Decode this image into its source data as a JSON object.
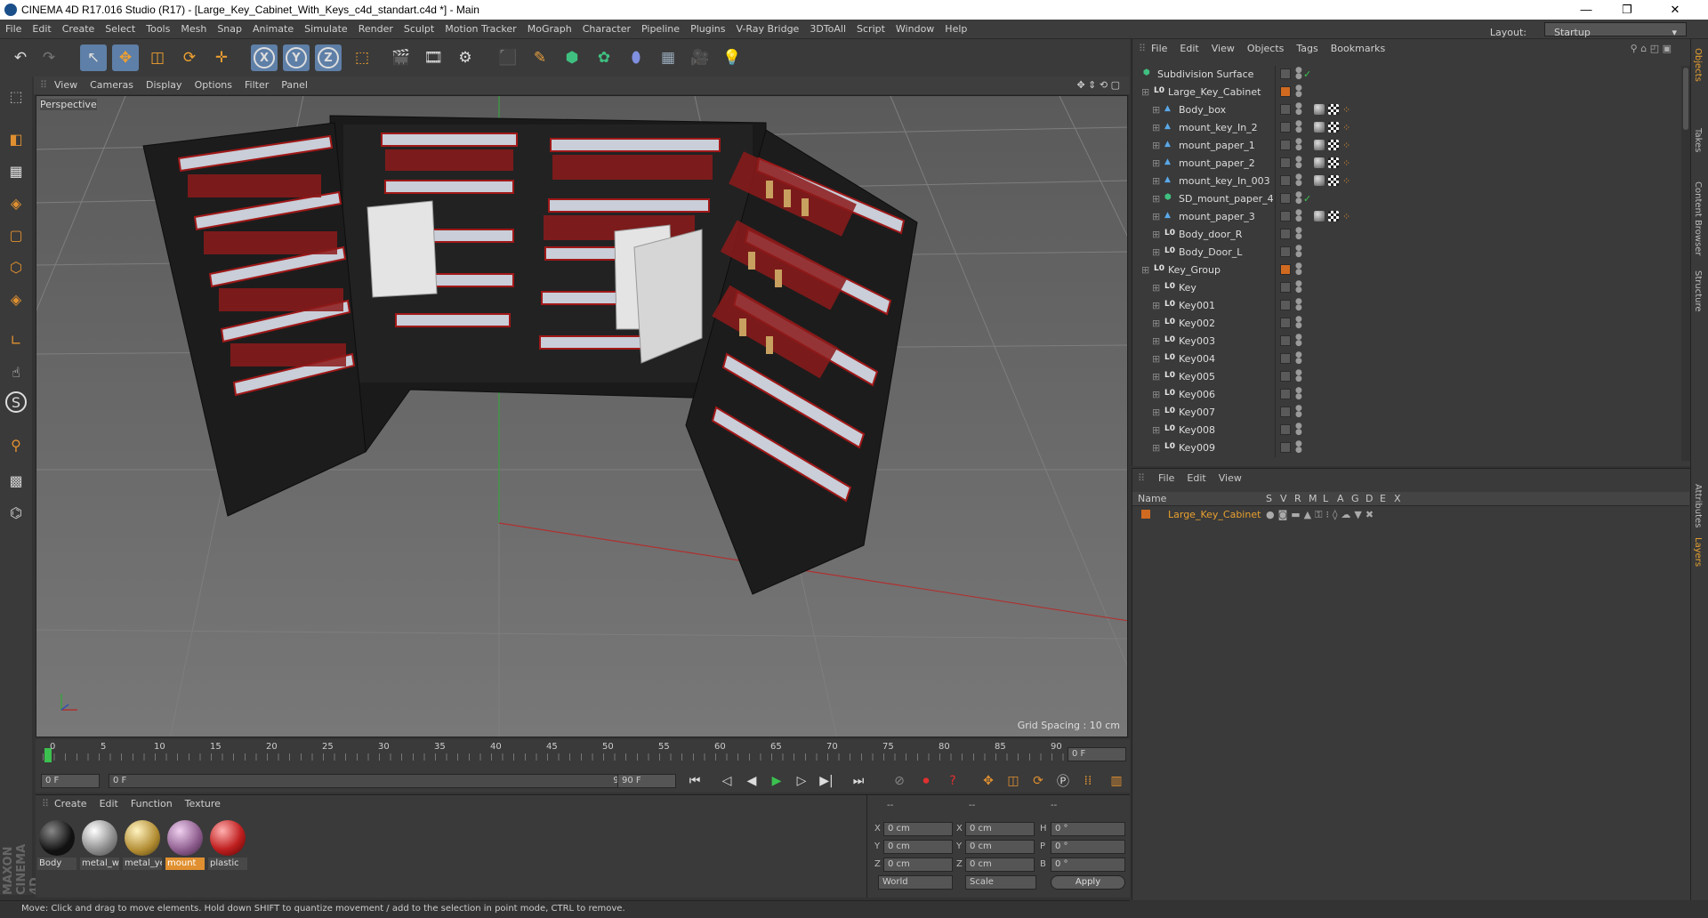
{
  "window": {
    "title": "CINEMA 4D R17.016 Studio (R17) - [Large_Key_Cabinet_With_Keys_c4d_standart.c4d *] - Main",
    "minimize": "—",
    "maximize": "❐",
    "close": "✕"
  },
  "menubar": {
    "items": [
      "File",
      "Edit",
      "Create",
      "Select",
      "Tools",
      "Mesh",
      "Snap",
      "Animate",
      "Simulate",
      "Render",
      "Sculpt",
      "Motion Tracker",
      "MoGraph",
      "Character",
      "Pipeline",
      "Plugins",
      "V-Ray Bridge",
      "3DToAll",
      "Script",
      "Window",
      "Help"
    ],
    "layout_label": "Layout:",
    "layout_value": "Startup"
  },
  "toolbar": {
    "undo": "↶",
    "redo": "↷",
    "select": "↖",
    "move": "✥",
    "scale": "◫",
    "rotate": "⟳",
    "live": "✛",
    "x": "X",
    "y": "Y",
    "z": "Z",
    "coord": "⬚",
    "render_view": "🎬",
    "render_pic": "🎞",
    "render_set": "⚙",
    "cube": "⬛",
    "pen": "✎",
    "subdiv": "⬢",
    "array": "✿",
    "deform": "⬮",
    "floor": "▦",
    "camera": "🎥",
    "light": "💡"
  },
  "left_tools": {
    "t1": "⬚",
    "t2": "◧",
    "t3": "▦",
    "t4": "◈",
    "t5": "▢",
    "t6": "⬡",
    "t7": "∟",
    "t8": "☝",
    "t9": "S",
    "t10": "⚲",
    "t11": "▩",
    "t12": "⌬"
  },
  "viewport": {
    "menu": [
      "View",
      "Cameras",
      "Display",
      "Options",
      "Filter",
      "Panel"
    ],
    "label": "Perspective",
    "grid_spacing": "Grid Spacing : 10 cm",
    "nav": "✥ ⇕ ⟲ ▢"
  },
  "timeline": {
    "ticks": [
      "0",
      "5",
      "10",
      "15",
      "20",
      "25",
      "30",
      "35",
      "40",
      "45",
      "50",
      "55",
      "60",
      "65",
      "70",
      "75",
      "80",
      "85",
      "90"
    ],
    "current": "0 F",
    "start": "0 F",
    "range_start": "0 F",
    "range_end": "90 F",
    "end": "90 F"
  },
  "playback": {
    "first": "⏮",
    "prev_key": "◁",
    "prev": "◀",
    "play": "▶",
    "next": "▷",
    "next_key": "▶|",
    "last": "⏭"
  },
  "materials": {
    "menu": [
      "Create",
      "Edit",
      "Function",
      "Texture"
    ],
    "items": [
      {
        "name": "Body",
        "color": "#222"
      },
      {
        "name": "metal_w",
        "color": "#aaa"
      },
      {
        "name": "metal_ye",
        "color": "#c9a24a"
      },
      {
        "name": "mount",
        "color": "#b07ab0"
      },
      {
        "name": "plastic",
        "color": "#c02020"
      }
    ]
  },
  "coords": {
    "headers": [
      "--",
      "--",
      "--"
    ],
    "x_pos": "0 cm",
    "y_pos": "0 cm",
    "z_pos": "0 cm",
    "x_size": "0 cm",
    "y_size": "0 cm",
    "z_size": "0 cm",
    "h": "0 °",
    "p": "0 °",
    "b": "0 °",
    "X": "X",
    "Y": "Y",
    "Z": "Z",
    "H": "H",
    "P": "P",
    "B": "B",
    "world": "World",
    "scale": "Scale",
    "apply": "Apply"
  },
  "status": "Move: Click and drag to move elements. Hold down SHIFT to quantize movement / add to the selection in point mode, CTRL to remove.",
  "objects": {
    "menu": [
      "File",
      "Edit",
      "View",
      "Objects",
      "Tags",
      "Bookmarks"
    ],
    "rows": [
      {
        "name": "Subdivision Surface",
        "indent": 0,
        "icon": "subdiv",
        "check": "✓"
      },
      {
        "name": "Large_Key_Cabinet",
        "indent": 1,
        "icon": "null",
        "color": "#d06a20"
      },
      {
        "name": "Body_box",
        "indent": 2,
        "icon": "poly",
        "tags": true
      },
      {
        "name": "mount_key_In_2",
        "indent": 2,
        "icon": "poly",
        "tags": true
      },
      {
        "name": "mount_paper_1",
        "indent": 2,
        "icon": "poly",
        "tags": true
      },
      {
        "name": "mount_paper_2",
        "indent": 2,
        "icon": "poly",
        "tags": true
      },
      {
        "name": "mount_key_In_003",
        "indent": 2,
        "icon": "poly",
        "tags": true
      },
      {
        "name": "SD_mount_paper_4",
        "indent": 2,
        "icon": "subdiv",
        "check": "✓"
      },
      {
        "name": "mount_paper_3",
        "indent": 2,
        "icon": "poly",
        "tags": true
      },
      {
        "name": "Body_door_R",
        "indent": 2,
        "icon": "null"
      },
      {
        "name": "Body_Door_L",
        "indent": 2,
        "icon": "null"
      },
      {
        "name": "Key_Group",
        "indent": 1,
        "icon": "null",
        "color": "#d06a20"
      },
      {
        "name": "Key",
        "indent": 2,
        "icon": "null"
      },
      {
        "name": "Key001",
        "indent": 2,
        "icon": "null"
      },
      {
        "name": "Key002",
        "indent": 2,
        "icon": "null"
      },
      {
        "name": "Key003",
        "indent": 2,
        "icon": "null"
      },
      {
        "name": "Key004",
        "indent": 2,
        "icon": "null"
      },
      {
        "name": "Key005",
        "indent": 2,
        "icon": "null"
      },
      {
        "name": "Key006",
        "indent": 2,
        "icon": "null"
      },
      {
        "name": "Key007",
        "indent": 2,
        "icon": "null"
      },
      {
        "name": "Key008",
        "indent": 2,
        "icon": "null"
      },
      {
        "name": "Key009",
        "indent": 2,
        "icon": "null"
      }
    ]
  },
  "layers": {
    "menu": [
      "File",
      "Edit",
      "View"
    ],
    "header_name": "Name",
    "cols": [
      "S",
      "V",
      "R",
      "M",
      "L",
      "A",
      "G",
      "D",
      "E",
      "X"
    ],
    "row": "Large_Key_Cabinet",
    "row_color": "#d06a20"
  },
  "right_tabs": [
    {
      "label": "Objects",
      "on": true
    },
    {
      "label": "Takes",
      "on": false
    },
    {
      "label": "Content Browser",
      "on": false
    },
    {
      "label": "Structure",
      "on": false
    },
    {
      "label": "Attributes",
      "on": false
    },
    {
      "label": "Layers",
      "on": true
    }
  ],
  "brand": "MAXON CINEMA 4D"
}
